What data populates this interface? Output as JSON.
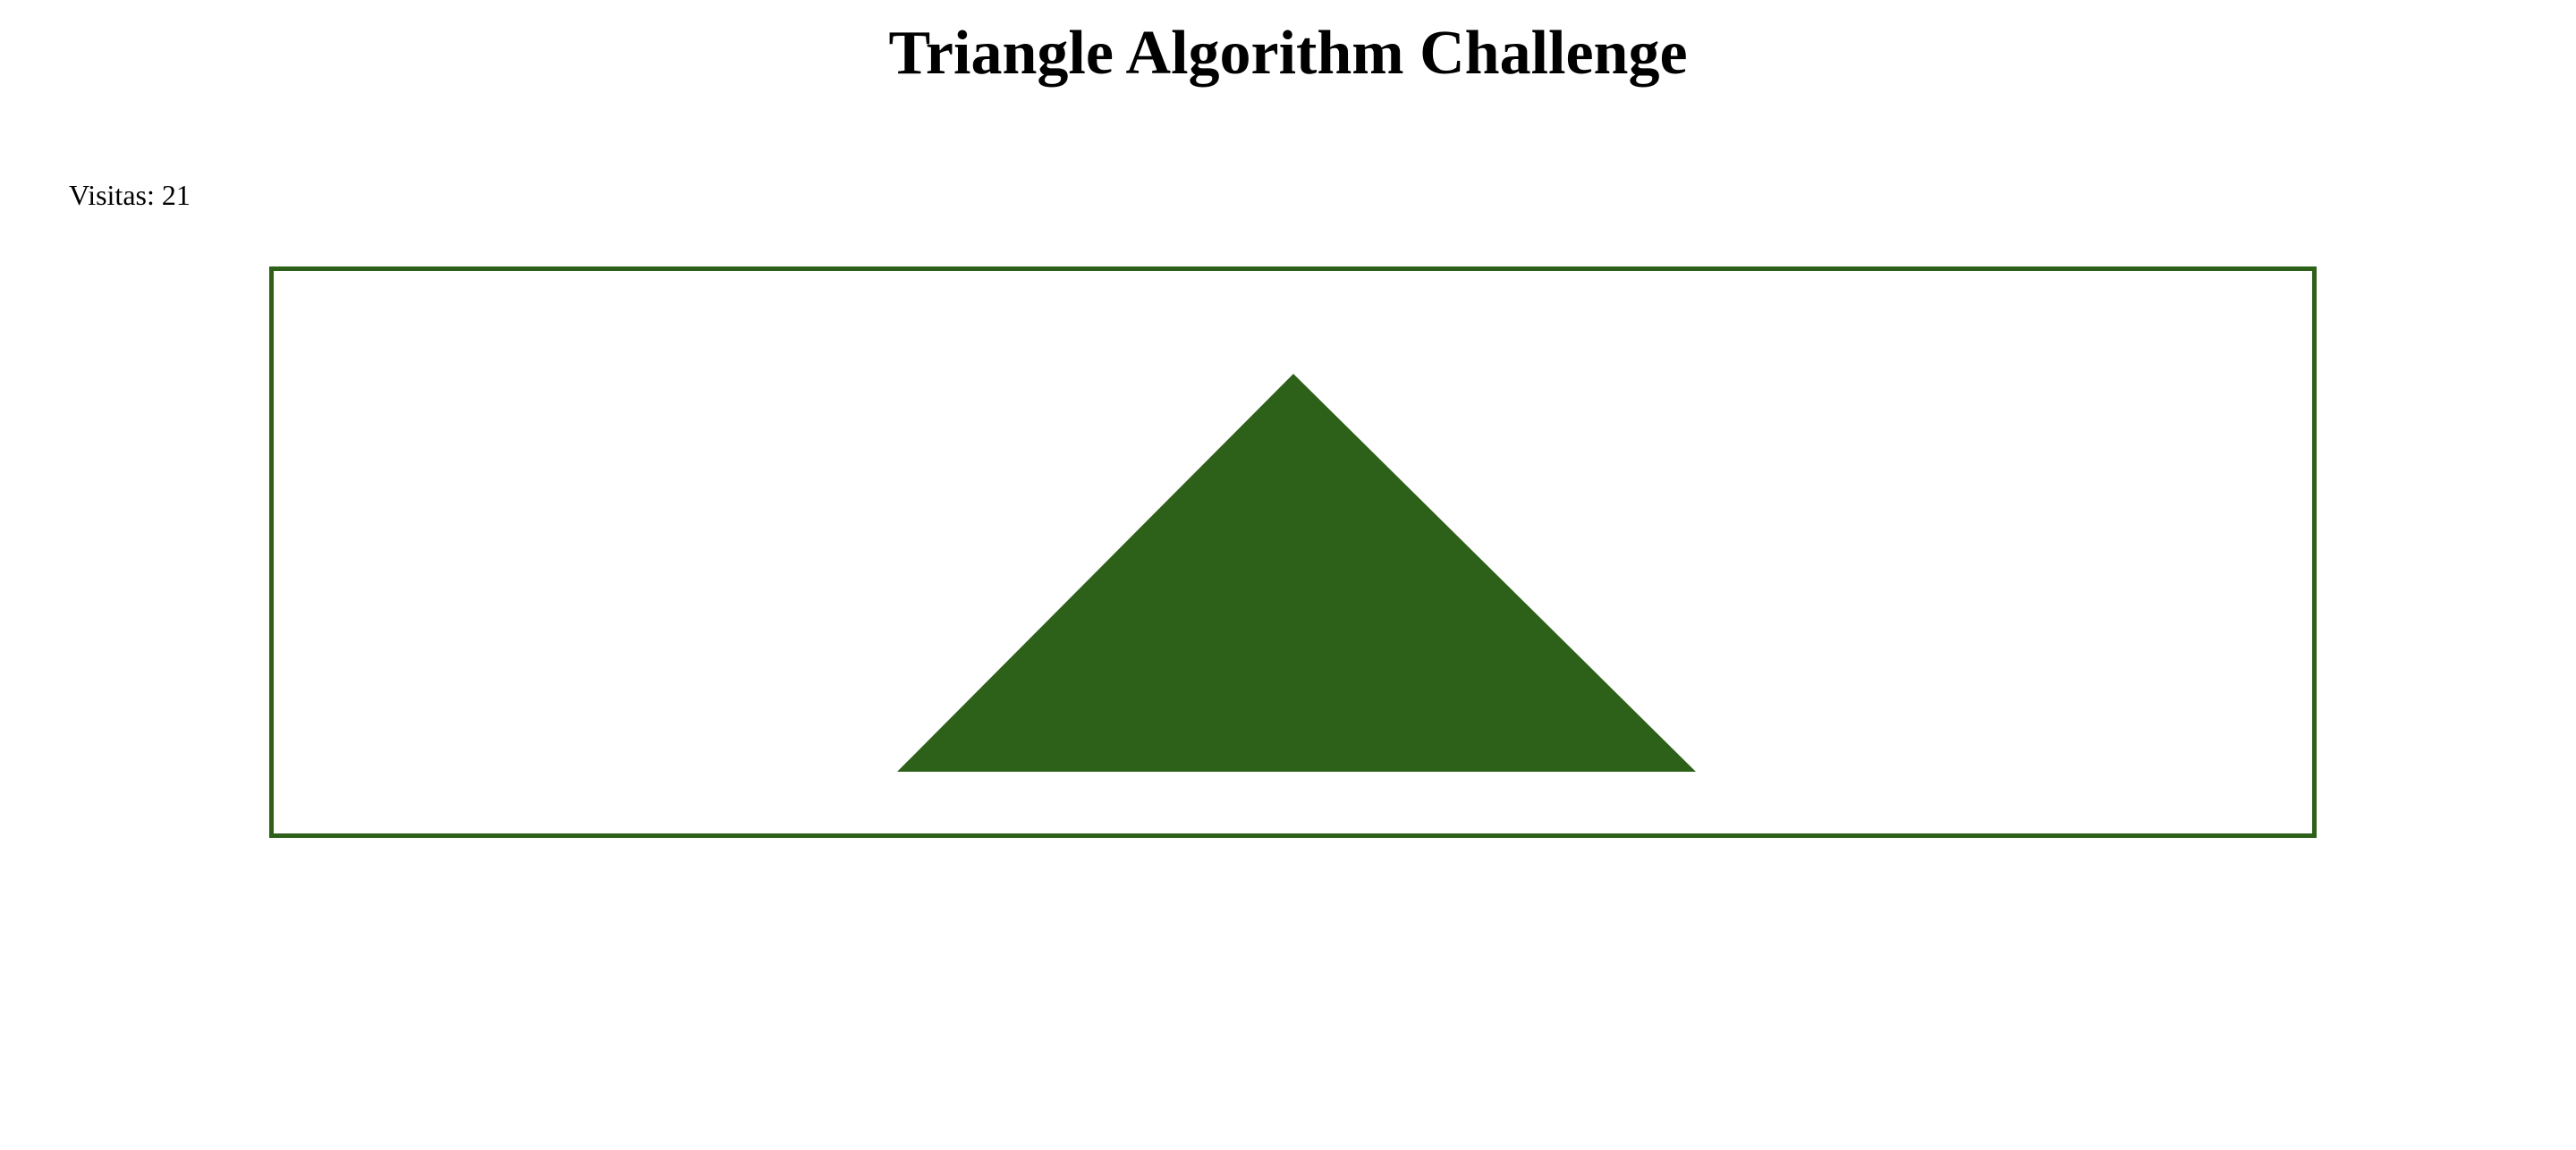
{
  "page": {
    "title": "Triangle Algorithm Challenge"
  },
  "visits": {
    "label": "Visitas:",
    "count": "21"
  },
  "canvas": {
    "shape": "triangle",
    "fill_color": "#2d6018",
    "border_color": "#2d6018"
  }
}
